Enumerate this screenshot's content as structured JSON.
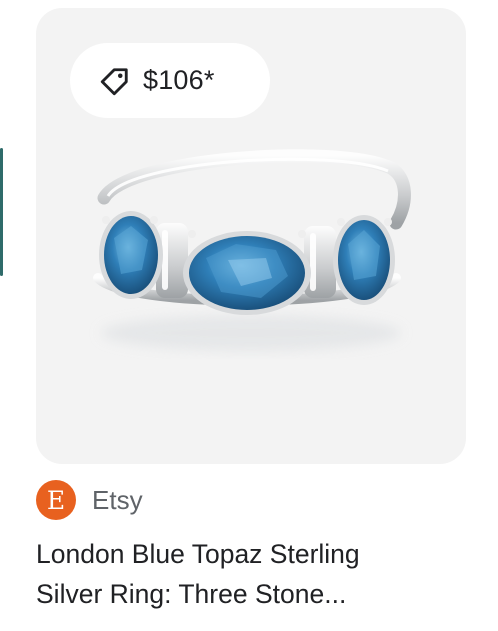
{
  "product": {
    "price": "$106*",
    "price_icon": "price-tag-icon",
    "image_alt": "three-stone blue topaz sterling silver ring",
    "source": {
      "logo_letter": "E",
      "name": "Etsy",
      "brand_color": "#e8611f"
    },
    "title_lines": [
      "London Blue Topaz Sterling",
      "Silver Ring: Three Stone..."
    ]
  }
}
